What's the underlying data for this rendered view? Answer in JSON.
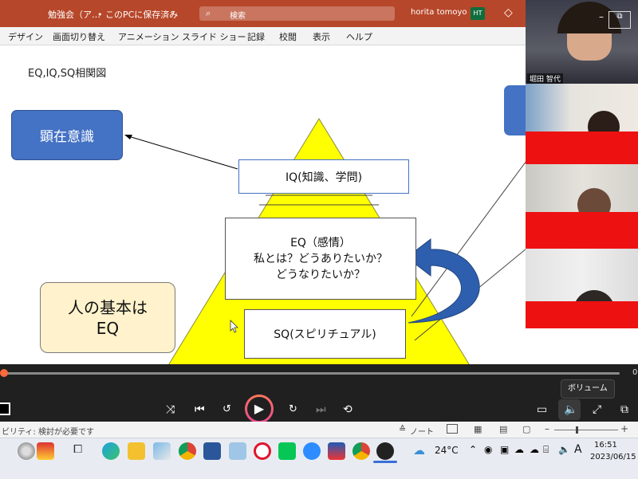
{
  "titlebar": {
    "doc_title": "勉強会（ア…",
    "save_state": "• このPCに保存済み",
    "search_placeholder": "検索",
    "user_name": "horita tomoyo",
    "user_initials": "HT"
  },
  "ribbon": {
    "tabs": [
      "デザイン",
      "画面切り替え",
      "アニメーション",
      "スライド ショー",
      "記録",
      "校閲",
      "表示",
      "ヘルプ"
    ]
  },
  "slide": {
    "title": "EQ,IQ,SQ相関図",
    "conscious_label": "顕在意識",
    "iq_label": "IQ(知識、学問)",
    "eq_label_line1": "EQ（感情）",
    "eq_label_line2": "私とは？どうありたいか？",
    "eq_label_line3": "どうなりたいか？",
    "sq_label": "SQ(スピリチュアル)",
    "basic_line1": "人の基本は",
    "basic_line2": "EQ",
    "colors": {
      "triangle": "#ffff00",
      "blue_box": "#4472c4",
      "cream_box": "#fff2cc",
      "arrow": "#2e5fae"
    }
  },
  "video": {
    "participant_name": "堀田 智代"
  },
  "player": {
    "volume_tooltip": "ボリューム",
    "time_right": "0"
  },
  "status": {
    "accessibility": "ビリティ: 検討が必要です",
    "notes_label": "ノート"
  },
  "taskbar": {
    "weather": "24°C",
    "time": "16:51",
    "date": "2023/06/15",
    "ime": "A"
  }
}
